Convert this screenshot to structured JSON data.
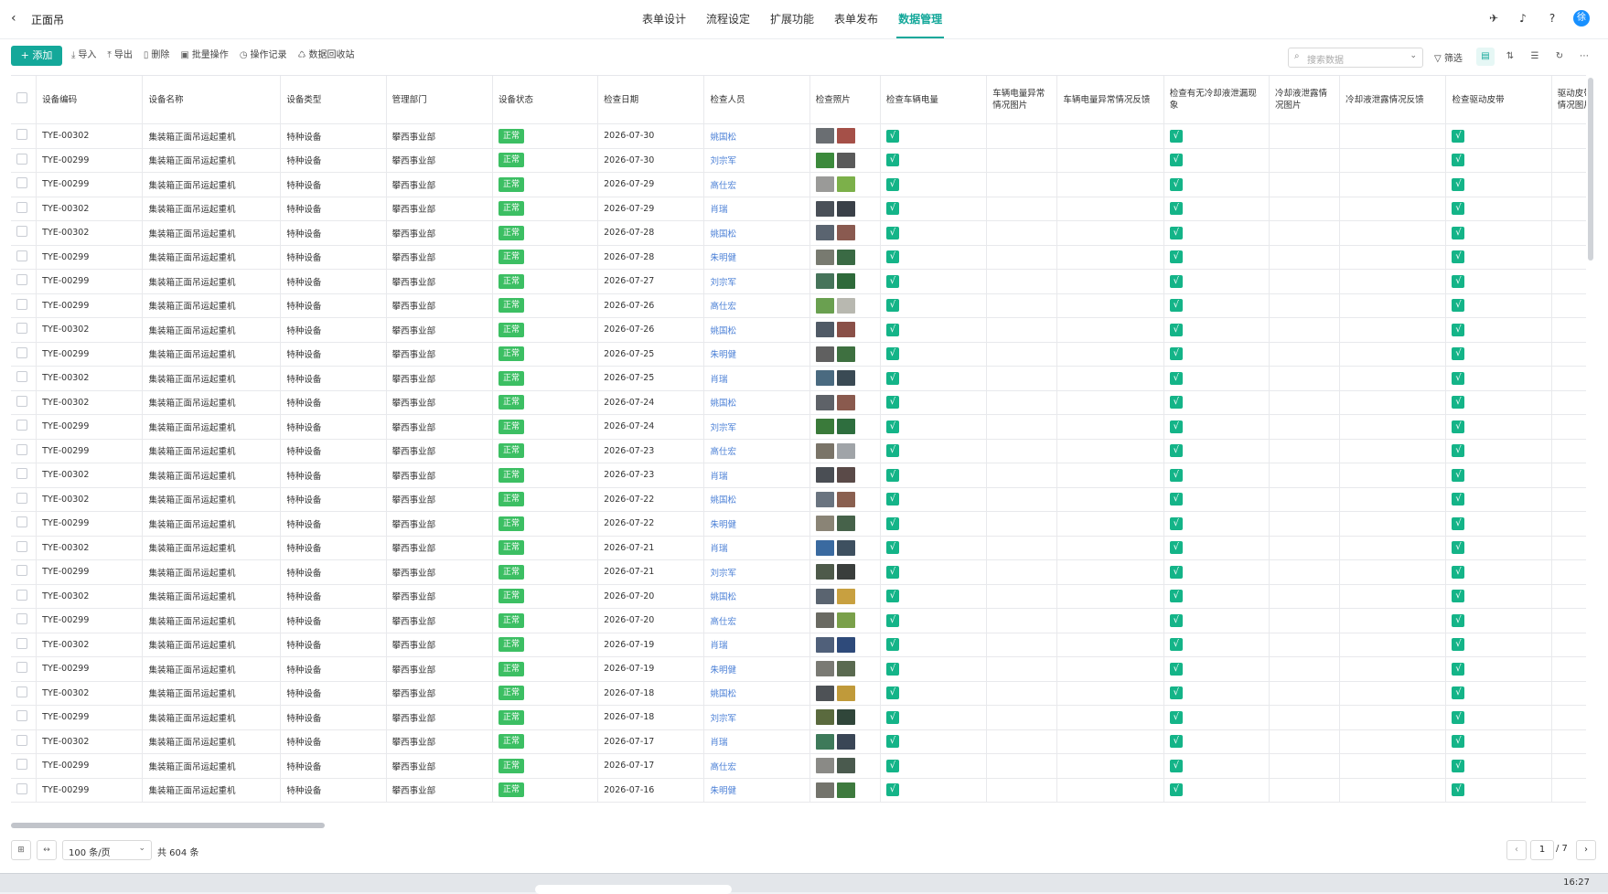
{
  "header": {
    "back_icon": "chevron-left-icon",
    "title": "正面吊",
    "nav": [
      "表单设计",
      "流程设定",
      "扩展功能",
      "表单发布",
      "数据管理"
    ],
    "active_nav_index": 4,
    "icons": [
      "compass-icon",
      "bell-icon",
      "help-icon"
    ],
    "avatar": "徐"
  },
  "toolbar": {
    "add_label": "添加",
    "items": [
      {
        "icon": "import-icon",
        "label": "导入"
      },
      {
        "icon": "export-icon",
        "label": "导出"
      },
      {
        "icon": "trash-icon",
        "label": "删除"
      },
      {
        "icon": "batch-icon",
        "label": "批量操作"
      },
      {
        "icon": "history-icon",
        "label": "操作记录"
      },
      {
        "icon": "recycle-icon",
        "label": "数据回收站"
      }
    ],
    "search_placeholder": "搜索数据",
    "filter_label": "筛选",
    "right_icons": [
      "card-view-icon",
      "sort-icon",
      "group-icon",
      "refresh-icon",
      "more-icon"
    ]
  },
  "table": {
    "columns": [
      "设备编码",
      "设备名称",
      "设备类型",
      "管理部门",
      "设备状态",
      "检查日期",
      "检查人员",
      "检查照片",
      "检查车辆电量",
      "车辆电量异常情况图片",
      "车辆电量异常情况反馈",
      "检查有无冷却液泄漏现象",
      "冷却液泄露情况图片",
      "冷却液泄露情况反馈",
      "检查驱动皮带",
      "驱动皮带异常情况图片"
    ],
    "status_text": "正常",
    "check_mark": "√",
    "rows": [
      {
        "code": "TYE-00302",
        "name": "集装箱正面吊运起重机",
        "type": "特种设备",
        "dept": "攀西事业部",
        "date": "2026-07-30",
        "person": "姚国松",
        "photos": [
          "#6a6e72",
          "#a55048"
        ]
      },
      {
        "code": "TYE-00299",
        "name": "集装箱正面吊运起重机",
        "type": "特种设备",
        "dept": "攀西事业部",
        "date": "2026-07-30",
        "person": "刘宗军",
        "photos": [
          "#3c8a3c",
          "#5a5a5a"
        ]
      },
      {
        "code": "TYE-00299",
        "name": "集装箱正面吊运起重机",
        "type": "特种设备",
        "dept": "攀西事业部",
        "date": "2026-07-29",
        "person": "高仕宏",
        "photos": [
          "#9a9a98",
          "#7cb04a"
        ]
      },
      {
        "code": "TYE-00302",
        "name": "集装箱正面吊运起重机",
        "type": "特种设备",
        "dept": "攀西事业部",
        "date": "2026-07-29",
        "person": "肖瑞",
        "photos": [
          "#4a5058",
          "#3a4048"
        ]
      },
      {
        "code": "TYE-00302",
        "name": "集装箱正面吊运起重机",
        "type": "特种设备",
        "dept": "攀西事业部",
        "date": "2026-07-28",
        "person": "姚国松",
        "photos": [
          "#5a6470",
          "#8a5a50"
        ]
      },
      {
        "code": "TYE-00299",
        "name": "集装箱正面吊运起重机",
        "type": "特种设备",
        "dept": "攀西事业部",
        "date": "2026-07-28",
        "person": "朱明健",
        "photos": [
          "#787a70",
          "#3a6a44"
        ]
      },
      {
        "code": "TYE-00299",
        "name": "集装箱正面吊运起重机",
        "type": "特种设备",
        "dept": "攀西事业部",
        "date": "2026-07-27",
        "person": "刘宗军",
        "photos": [
          "#46745a",
          "#2e6a3a"
        ]
      },
      {
        "code": "TYE-00299",
        "name": "集装箱正面吊运起重机",
        "type": "特种设备",
        "dept": "攀西事业部",
        "date": "2026-07-26",
        "person": "高仕宏",
        "photos": [
          "#6aa050",
          "#b8b8b0"
        ]
      },
      {
        "code": "TYE-00302",
        "name": "集装箱正面吊运起重机",
        "type": "特种设备",
        "dept": "攀西事业部",
        "date": "2026-07-26",
        "person": "姚国松",
        "photos": [
          "#505a66",
          "#8a5048"
        ]
      },
      {
        "code": "TYE-00299",
        "name": "集装箱正面吊运起重机",
        "type": "特种设备",
        "dept": "攀西事业部",
        "date": "2026-07-25",
        "person": "朱明健",
        "photos": [
          "#606060",
          "#3e7040"
        ]
      },
      {
        "code": "TYE-00302",
        "name": "集装箱正面吊运起重机",
        "type": "特种设备",
        "dept": "攀西事业部",
        "date": "2026-07-25",
        "person": "肖瑞",
        "photos": [
          "#4a6a80",
          "#3a4a54"
        ]
      },
      {
        "code": "TYE-00302",
        "name": "集装箱正面吊运起重机",
        "type": "特种设备",
        "dept": "攀西事业部",
        "date": "2026-07-24",
        "person": "姚国松",
        "photos": [
          "#5e6268",
          "#8a5a4e"
        ]
      },
      {
        "code": "TYE-00299",
        "name": "集装箱正面吊运起重机",
        "type": "特种设备",
        "dept": "攀西事业部",
        "date": "2026-07-24",
        "person": "刘宗军",
        "photos": [
          "#3a7a3a",
          "#2e6e3e"
        ]
      },
      {
        "code": "TYE-00299",
        "name": "集装箱正面吊运起重机",
        "type": "特种设备",
        "dept": "攀西事业部",
        "date": "2026-07-23",
        "person": "高仕宏",
        "photos": [
          "#7a7468",
          "#a0a4a8"
        ]
      },
      {
        "code": "TYE-00302",
        "name": "集装箱正面吊运起重机",
        "type": "特种设备",
        "dept": "攀西事业部",
        "date": "2026-07-23",
        "person": "肖瑞",
        "photos": [
          "#4a4e54",
          "#5a4a48"
        ]
      },
      {
        "code": "TYE-00302",
        "name": "集装箱正面吊运起重机",
        "type": "特种设备",
        "dept": "攀西事业部",
        "date": "2026-07-22",
        "person": "姚国松",
        "photos": [
          "#6a7480",
          "#8a6050"
        ]
      },
      {
        "code": "TYE-00299",
        "name": "集装箱正面吊运起重机",
        "type": "特种设备",
        "dept": "攀西事业部",
        "date": "2026-07-22",
        "person": "朱明健",
        "photos": [
          "#8a8476",
          "#46624a"
        ]
      },
      {
        "code": "TYE-00302",
        "name": "集装箱正面吊运起重机",
        "type": "特种设备",
        "dept": "攀西事业部",
        "date": "2026-07-21",
        "person": "肖瑞",
        "photos": [
          "#3a6aa0",
          "#3e5060"
        ]
      },
      {
        "code": "TYE-00299",
        "name": "集装箱正面吊运起重机",
        "type": "特种设备",
        "dept": "攀西事业部",
        "date": "2026-07-21",
        "person": "刘宗军",
        "photos": [
          "#4e5a4a",
          "#3a3e3c"
        ]
      },
      {
        "code": "TYE-00302",
        "name": "集装箱正面吊运起重机",
        "type": "特种设备",
        "dept": "攀西事业部",
        "date": "2026-07-20",
        "person": "姚国松",
        "photos": [
          "#5a6470",
          "#c8a040"
        ]
      },
      {
        "code": "TYE-00299",
        "name": "集装箱正面吊运起重机",
        "type": "特种设备",
        "dept": "攀西事业部",
        "date": "2026-07-20",
        "person": "高仕宏",
        "photos": [
          "#6a6a62",
          "#7aa04a"
        ]
      },
      {
        "code": "TYE-00302",
        "name": "集装箱正面吊运起重机",
        "type": "特种设备",
        "dept": "攀西事业部",
        "date": "2026-07-19",
        "person": "肖瑞",
        "photos": [
          "#50607a",
          "#2e4a7a"
        ]
      },
      {
        "code": "TYE-00299",
        "name": "集装箱正面吊运起重机",
        "type": "特种设备",
        "dept": "攀西事业部",
        "date": "2026-07-19",
        "person": "朱明健",
        "photos": [
          "#7a7a74",
          "#5a6a50"
        ]
      },
      {
        "code": "TYE-00302",
        "name": "集装箱正面吊运起重机",
        "type": "特种设备",
        "dept": "攀西事业部",
        "date": "2026-07-18",
        "person": "姚国松",
        "photos": [
          "#4e5256",
          "#c09a3a"
        ]
      },
      {
        "code": "TYE-00299",
        "name": "集装箱正面吊运起重机",
        "type": "特种设备",
        "dept": "攀西事业部",
        "date": "2026-07-18",
        "person": "刘宗军",
        "photos": [
          "#5a6a3e",
          "#30463a"
        ]
      },
      {
        "code": "TYE-00302",
        "name": "集装箱正面吊运起重机",
        "type": "特种设备",
        "dept": "攀西事业部",
        "date": "2026-07-17",
        "person": "肖瑞",
        "photos": [
          "#3e7a5a",
          "#3a4656"
        ]
      },
      {
        "code": "TYE-00299",
        "name": "集装箱正面吊运起重机",
        "type": "特种设备",
        "dept": "攀西事业部",
        "date": "2026-07-17",
        "person": "高仕宏",
        "photos": [
          "#8a8a86",
          "#4a5a4e"
        ]
      },
      {
        "code": "TYE-00299",
        "name": "集装箱正面吊运起重机",
        "type": "特种设备",
        "dept": "攀西事业部",
        "date": "2026-07-16",
        "person": "朱明健",
        "photos": [
          "#74746c",
          "#3e7a3e"
        ]
      }
    ]
  },
  "footer": {
    "page_size": "100 条/页",
    "total": "共 604 条",
    "current_page": "1",
    "total_pages": "/ 7"
  },
  "taskbar": {
    "clock": "16:27"
  },
  "colors": {
    "accent": "#14a89a",
    "status_ok": "#3cbf63",
    "check": "#14b488",
    "person_link": "#4a7fd6"
  }
}
